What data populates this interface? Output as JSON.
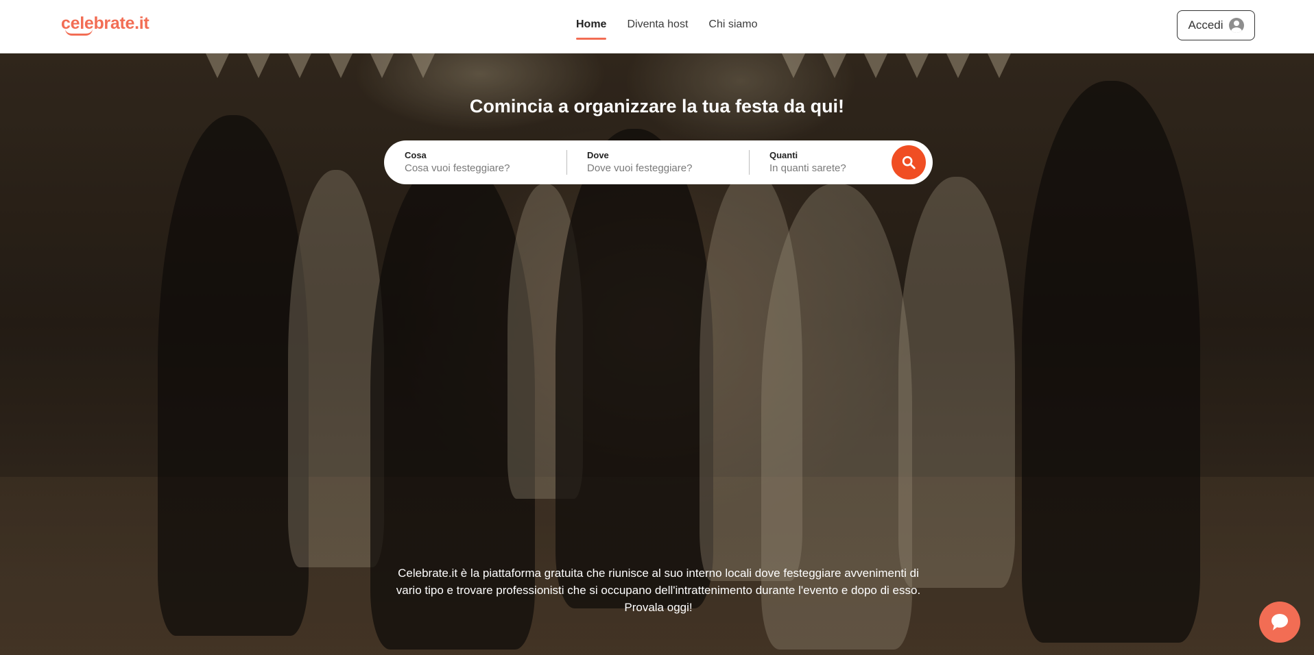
{
  "brand": {
    "logo_text": "celebrate.it",
    "accent_color": "#f26d54",
    "search_button_color": "#f04e23"
  },
  "nav": {
    "items": [
      {
        "label": "Home",
        "active": true
      },
      {
        "label": "Diventa host",
        "active": false
      },
      {
        "label": "Chi siamo",
        "active": false
      }
    ]
  },
  "header": {
    "login_label": "Accedi",
    "login_icon": "user-circle-icon"
  },
  "hero": {
    "title": "Comincia a organizzare la tua festa da qui!",
    "search": {
      "fields": [
        {
          "label": "Cosa",
          "placeholder": "Cosa vuoi festeggiare?"
        },
        {
          "label": "Dove",
          "placeholder": "Dove vuoi festeggiare?"
        },
        {
          "label": "Quanti",
          "placeholder": "In quanti sarete?"
        }
      ],
      "button_icon": "search-icon"
    },
    "description": "Celebrate.it è la piattaforma gratuita che riunisce al suo interno locali dove festeggiare avvenimenti di vario tipo e trovare professionisti che si occupano dell'intrattenimento durante l'evento e dopo di esso. Provala oggi!",
    "background": "photo of people dancing at a party in a tent"
  },
  "chat": {
    "icon": "chat-bubble-icon"
  }
}
